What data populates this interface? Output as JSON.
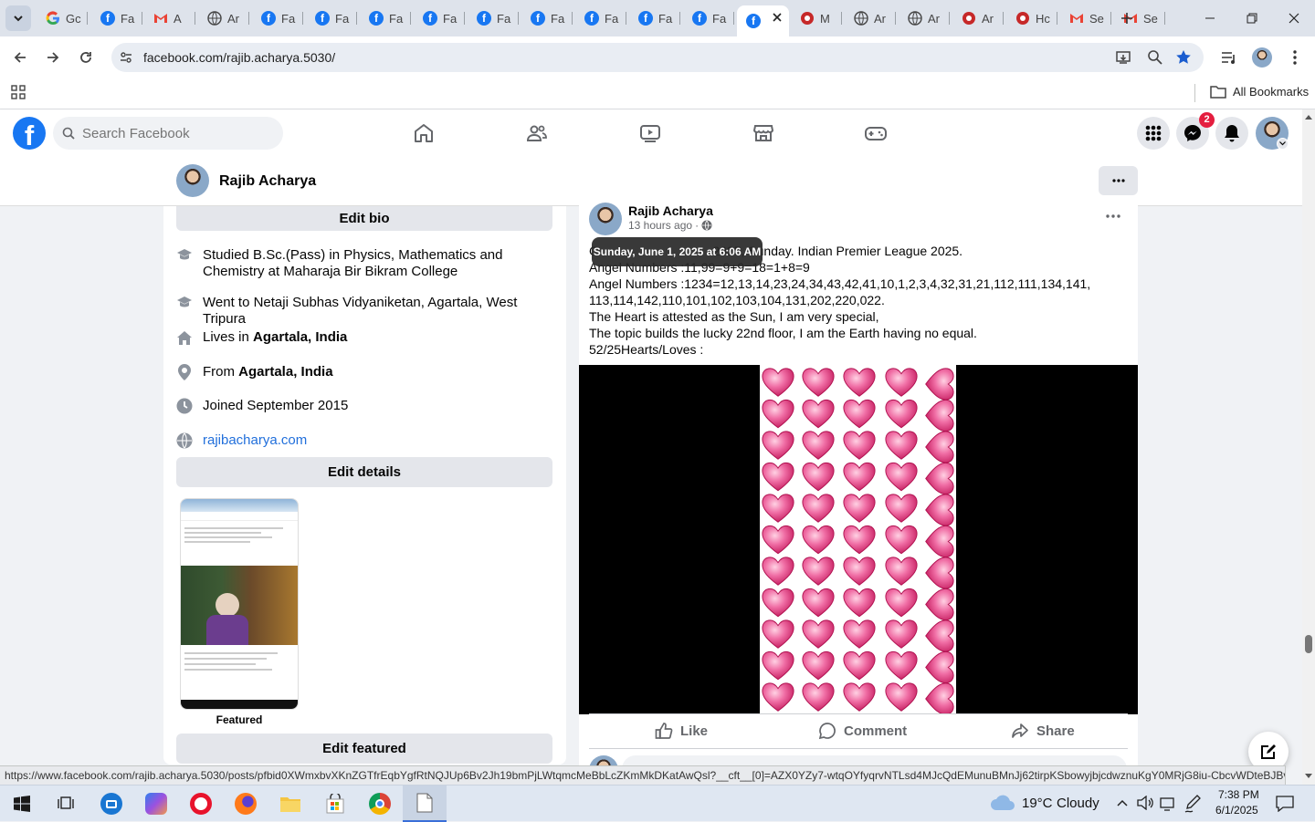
{
  "browser": {
    "tabs": [
      {
        "label": "Gc",
        "icon": "google-icon"
      },
      {
        "label": "Fa",
        "icon": "facebook-icon"
      },
      {
        "label": "A",
        "icon": "gmail-icon"
      },
      {
        "label": "Ar",
        "icon": "globe-icon"
      },
      {
        "label": "Fa",
        "icon": "facebook-icon"
      },
      {
        "label": "Fa",
        "icon": "facebook-icon"
      },
      {
        "label": "Fa",
        "icon": "facebook-icon"
      },
      {
        "label": "Fa",
        "icon": "facebook-icon"
      },
      {
        "label": "Fa",
        "icon": "facebook-icon"
      },
      {
        "label": "Fa",
        "icon": "facebook-icon"
      },
      {
        "label": "Fa",
        "icon": "facebook-icon"
      },
      {
        "label": "Fa",
        "icon": "facebook-icon"
      },
      {
        "label": "Fa",
        "icon": "facebook-icon"
      },
      {
        "label": "",
        "icon": "facebook-icon",
        "active": true
      },
      {
        "label": "M",
        "icon": "app-icon"
      },
      {
        "label": "Ar",
        "icon": "globe-icon"
      },
      {
        "label": "Ar",
        "icon": "globe-icon"
      },
      {
        "label": "Ar",
        "icon": "app-icon"
      },
      {
        "label": "Hc",
        "icon": "app-icon"
      },
      {
        "label": "Se",
        "icon": "gmail-icon"
      },
      {
        "label": "Se",
        "icon": "gmail-icon"
      }
    ],
    "url": "facebook.com/rajib.acharya.5030/",
    "all_bookmarks": "All Bookmarks",
    "status_url": "https://www.facebook.com/rajib.acharya.5030/posts/pfbid0XWmxbvXKnZGTfrEqbYgfRtNQJUp6Bv2Jh19bmPjLWtqmcMeBbLcZKmMkDKatAwQsl?__cft__[0]=AZX0YZy7-wtqOYfyqrvNTLsd4MJcQdEMunuBMnJj62tirpKSbowyjbjcdwznuKgY0MRjG8iu-CbcvWDteBJBvQ6..."
  },
  "facebook": {
    "search_placeholder": "Search Facebook",
    "messenger_badge": "2",
    "brand_color": "#1877f2"
  },
  "profile": {
    "name": "Rajib Acharya"
  },
  "intro": {
    "edit_bio": "Edit bio",
    "items": [
      {
        "icon": "education-icon",
        "text": "Studied B.Sc.(Pass) in Physics, Mathematics and Chemistry at Maharaja Bir Bikram College"
      },
      {
        "icon": "education-icon",
        "text": "Went to Netaji Subhas Vidyaniketan, Agartala, West Tripura"
      },
      {
        "icon": "home-icon",
        "prefix": "Lives in ",
        "bold": "Agartala, India"
      },
      {
        "icon": "location-pin-icon",
        "prefix": "From ",
        "bold": "Agartala, India"
      },
      {
        "icon": "clock-icon",
        "text": "Joined September 2015"
      },
      {
        "icon": "globe-icon",
        "link": "rajibacharya.com"
      }
    ],
    "edit_details": "Edit details",
    "featured_label": "Featured",
    "edit_featured": "Edit featured"
  },
  "post": {
    "author": "Rajib Acharya",
    "time": "13 hours ago",
    "dot": "·",
    "tooltip": "Sunday, June 1, 2025 at 6:06 AM",
    "lines": [
      "G                                2025, Sunday. Indian Premier League 2025.",
      "Angel Numbers :11,99=9+9=18=1+8=9",
      "Angel Numbers :1234=12,13,14,23,24,34,43,42,41,10,1,2,3,4,32,31,21,112,111,134,141,",
      "113,114,142,110,101,102,103,104,131,202,220,022.",
      "The Heart is attested as the Sun, I am very special,",
      "The topic builds the lucky 22nd floor, I am the Earth having no equal.",
      "52/25Hearts/Loves :"
    ],
    "actions": {
      "like": "Like",
      "comment": "Comment",
      "share": "Share"
    }
  },
  "taskbar": {
    "weather_temp": "19°C",
    "weather_desc": "Cloudy",
    "time": "7:38 PM",
    "date": "6/1/2025"
  }
}
